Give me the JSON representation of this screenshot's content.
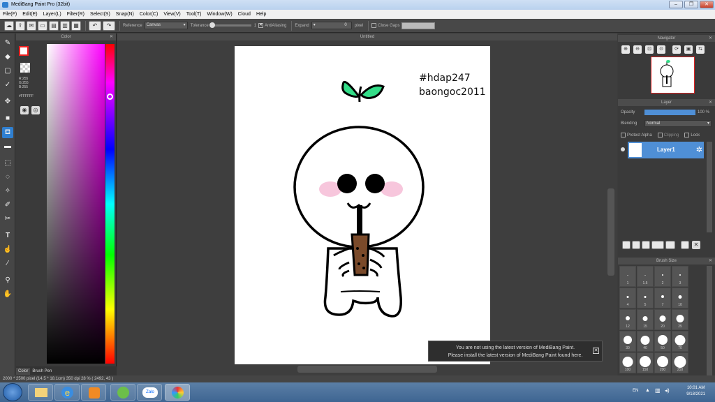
{
  "window": {
    "title": "MediBang Paint Pro (32bit)"
  },
  "menu": [
    "File(F)",
    "Edit(E)",
    "Layer(L)",
    "Filter(R)",
    "Select(S)",
    "Snap(N)",
    "Color(C)",
    "View(V)",
    "Tool(T)",
    "Window(W)",
    "Cloud",
    "Help"
  ],
  "toolbar": {
    "reference_label": "Reference",
    "reference_value": "Canvas",
    "tolerance_label": "Tolerance",
    "tolerance_value": "1",
    "antialiasing_label": "AntiAliasing",
    "expand_label": "Expand",
    "expand_value": "0",
    "expand_unit": "pixel",
    "close_gaps_label": "Close Gaps"
  },
  "color_panel": {
    "header": "Color",
    "rgb": [
      "R:255",
      "G:255",
      "B:255"
    ],
    "hex": "#FFFFFF",
    "tab_color": "Color",
    "tab_brush": "Brush Pen"
  },
  "canvas": {
    "header": "Untitled",
    "text_line1": "#hdap247",
    "text_line2": "baongoc2011"
  },
  "notice": {
    "line1": "You are not using the latest version of MediBang Paint.",
    "line2": "Please install the latest version of MediBang Paint found here."
  },
  "navigator": {
    "header": "Navigator"
  },
  "layer_panel": {
    "header": "Layer",
    "opacity_label": "Opacity",
    "opacity_value": "100 %",
    "opacity_level": 1.0,
    "blending_label": "Blending",
    "blending_value": "Normal",
    "protect_alpha": "Protect Alpha",
    "clipping": "Clipping",
    "lock": "Lock",
    "layer_name": "Layer1"
  },
  "brush_size": {
    "header": "Brush Size",
    "sizes": [
      "1",
      "1.5",
      "2",
      "3",
      "4",
      "5",
      "7",
      "10",
      "12",
      "15",
      "20",
      "25",
      "30",
      "40",
      "50",
      "70",
      "100",
      "150",
      "200",
      "250"
    ]
  },
  "status": {
    "text": "2000 * 2500 pixel  (14.5 * 18.1cm)  350 dpi  28 %  ( 2492, 43 )"
  },
  "taskbar": {
    "lang": "EN",
    "time": "10:01 AM",
    "date": "9/18/2021",
    "zalo_label": "Zalo"
  },
  "colors": {
    "accent": "#2f7fd0",
    "leaf": "#33dd88",
    "blush": "#f7c6dc",
    "tea": "#7a4a2a"
  }
}
